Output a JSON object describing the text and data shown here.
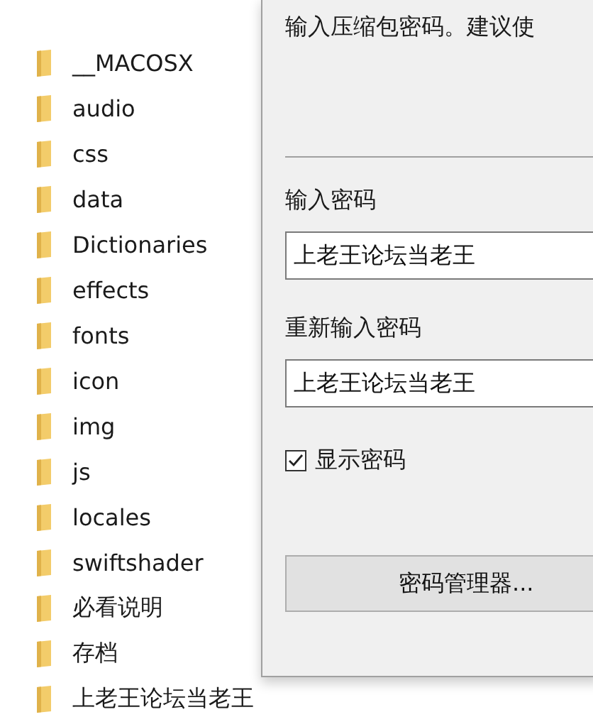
{
  "folders": [
    {
      "name": "__MACOSX"
    },
    {
      "name": "audio"
    },
    {
      "name": "css"
    },
    {
      "name": "data"
    },
    {
      "name": "Dictionaries"
    },
    {
      "name": "effects"
    },
    {
      "name": "fonts"
    },
    {
      "name": "icon"
    },
    {
      "name": "img"
    },
    {
      "name": "js"
    },
    {
      "name": "locales"
    },
    {
      "name": "swiftshader"
    },
    {
      "name": "必看说明"
    },
    {
      "name": "存档"
    },
    {
      "name": "上老王论坛当老王"
    }
  ],
  "dialog": {
    "description": "输入压缩包密码。建议使",
    "password_label": "输入密码",
    "password_value": "上老王论坛当老王",
    "repeat_label": "重新输入密码",
    "repeat_value": "上老王论坛当老王",
    "show_password": {
      "label": "显示密码",
      "checked": true
    },
    "manager_button": "密码管理器..."
  }
}
